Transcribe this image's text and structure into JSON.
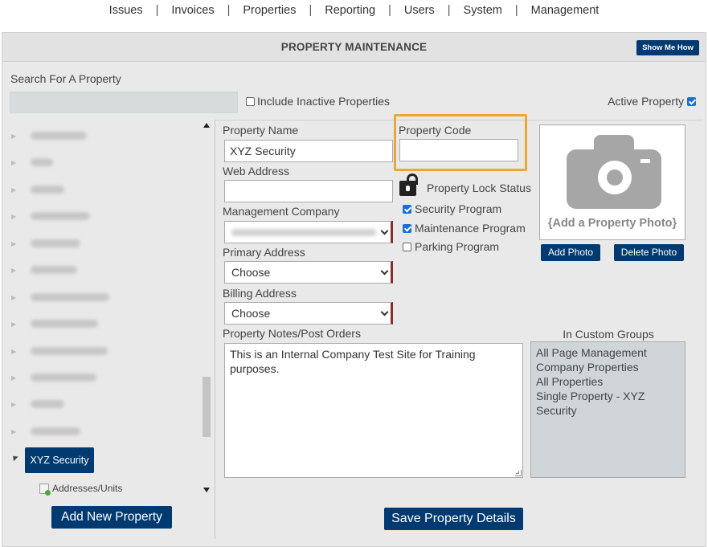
{
  "nav": {
    "items": [
      "Issues",
      "Invoices",
      "Properties",
      "Reporting",
      "Users",
      "System",
      "Management"
    ],
    "separator": "|"
  },
  "header": {
    "title": "PROPERTY MAINTENANCE",
    "show_me_how": "Show Me How"
  },
  "search": {
    "label": "Search For A Property",
    "value": "",
    "include_inactive_label": "Include Inactive Properties",
    "include_inactive_checked": false,
    "active_property_label": "Active Property",
    "active_property_checked": true
  },
  "tree": {
    "selected": "XYZ Security",
    "child": "Addresses/Units",
    "add_button": "Add New Property"
  },
  "form": {
    "property_name_label": "Property Name",
    "property_name_value": "XYZ Security",
    "property_code_label": "Property Code",
    "property_code_value": "",
    "web_address_label": "Web Address",
    "web_address_value": "",
    "lock_status_label": "Property Lock Status",
    "management_company_label": "Management Company",
    "primary_address_label": "Primary Address",
    "primary_address_value": "Choose",
    "billing_address_label": "Billing Address",
    "billing_address_value": "Choose",
    "programs": [
      {
        "label": "Security Program",
        "checked": true
      },
      {
        "label": "Maintenance Program",
        "checked": true
      },
      {
        "label": "Parking Program",
        "checked": false
      }
    ],
    "notes_label": "Property Notes/Post Orders",
    "notes_value": "This is an Internal Company Test Site for Training purposes.",
    "save_button": "Save Property Details"
  },
  "photo": {
    "caption": "{Add a Property Photo}",
    "add_button": "Add Photo",
    "delete_button": "Delete Photo"
  },
  "groups": {
    "label": "In Custom Groups",
    "items": [
      "All Page Management",
      "Company Properties",
      "All Properties",
      "Single Property - XYZ",
      "Security"
    ]
  },
  "colors": {
    "accent": "#003a70",
    "highlight": "#e8a838",
    "panel_bg": "#e9e9e9"
  }
}
